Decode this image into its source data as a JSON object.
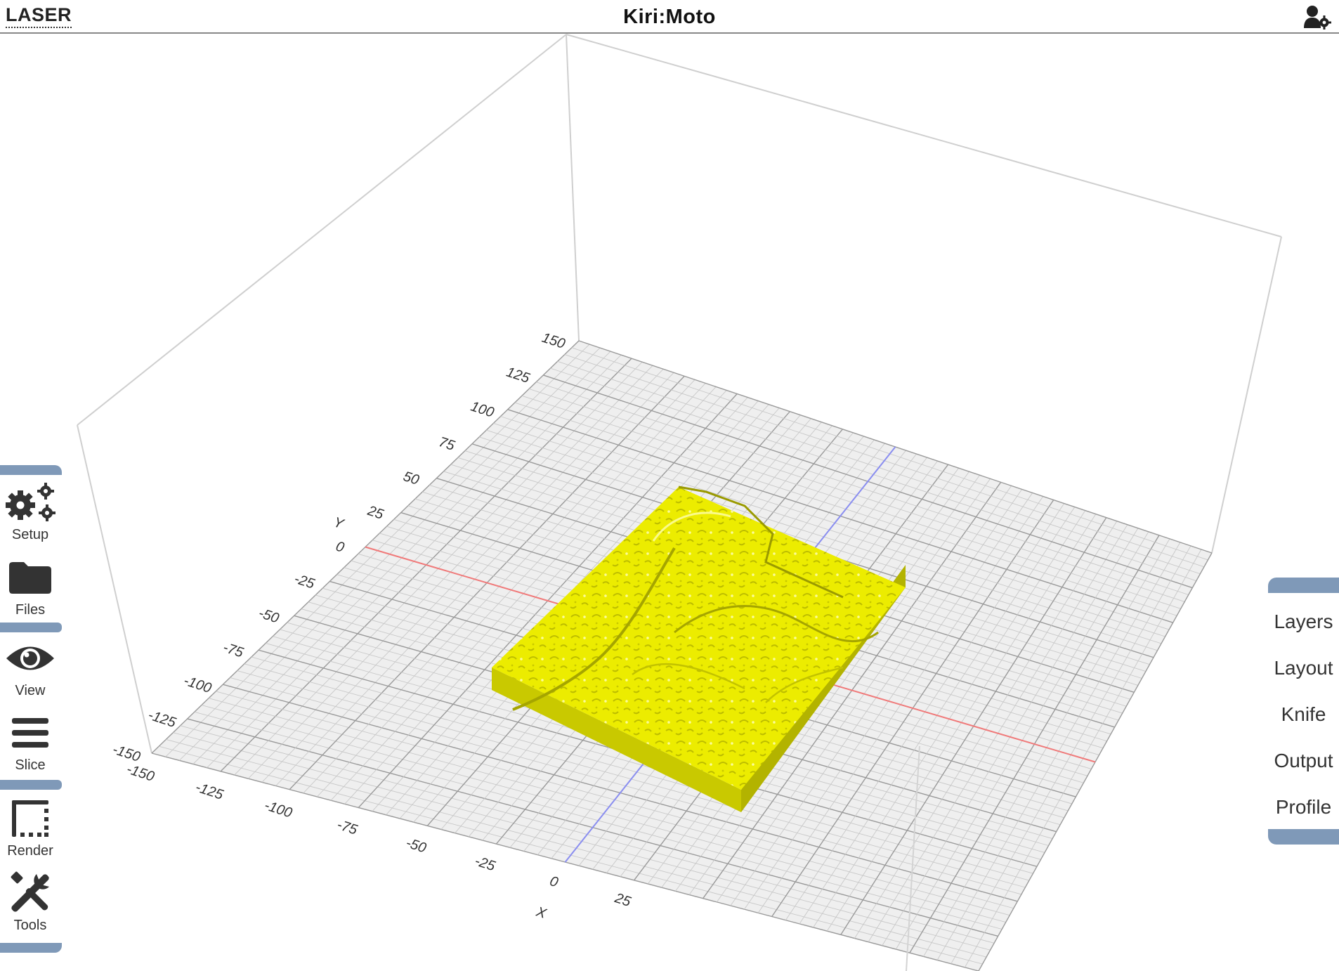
{
  "header": {
    "mode": "LASER",
    "title": "Kiri:Moto",
    "user_icon": "user-settings-icon"
  },
  "toolbar": {
    "items": [
      {
        "label": "Setup",
        "icon": "gears-icon"
      },
      {
        "label": "Files",
        "icon": "folder-icon"
      },
      {
        "label": "View",
        "icon": "eye-icon"
      },
      {
        "label": "Slice",
        "icon": "bars-icon"
      },
      {
        "label": "Render",
        "icon": "render-frame-icon"
      },
      {
        "label": "Tools",
        "icon": "tools-icon"
      }
    ]
  },
  "right_menu": {
    "items": [
      "Layers",
      "Layout",
      "Knife",
      "Output",
      "Profile"
    ]
  },
  "viewport": {
    "x_axis_letter": "X",
    "y_axis_letter": "Y",
    "x_ticks": [
      "-150",
      "-125",
      "-100",
      "-75",
      "-50",
      "-25",
      "0",
      "25"
    ],
    "y_ticks": [
      "-150",
      "-125",
      "-100",
      "-75",
      "-50",
      "-25",
      "0",
      "25",
      "50",
      "75",
      "100",
      "125",
      "150"
    ],
    "model_color": "#ecec00",
    "x_axis_color": "#f07a7a",
    "y_axis_color": "#8a8ef0",
    "toolbar_accent": "#7f99b8"
  }
}
